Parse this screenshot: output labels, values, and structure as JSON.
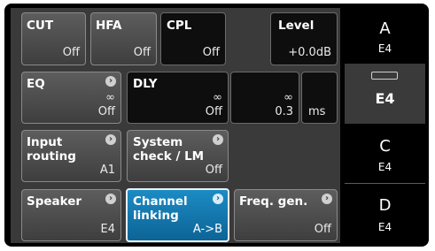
{
  "top_row": {
    "cut": {
      "label": "CUT",
      "value": "Off"
    },
    "hfa": {
      "label": "HFA",
      "value": "Off"
    },
    "cpl": {
      "label": "CPL",
      "value": "Off"
    },
    "level": {
      "label": "Level",
      "value": "+0.0dB"
    }
  },
  "second_row": {
    "eq": {
      "label": "EQ",
      "symbol": "∞",
      "value": "Off"
    },
    "dly": {
      "label": "DLY",
      "symbol": "∞",
      "value": "Off"
    },
    "dly_val": {
      "symbol": "∞",
      "value": "0.3"
    },
    "unit": {
      "value": "ms"
    }
  },
  "third_row": {
    "input_routing": {
      "label": "Input\nrouting",
      "value": "A1"
    },
    "system_check": {
      "label": "System\ncheck / LM",
      "value": "Off"
    }
  },
  "fourth_row": {
    "speaker": {
      "label": "Speaker",
      "value": "E4"
    },
    "channel_linking": {
      "label": "Channel\nlinking",
      "value": "A->B"
    },
    "freq_gen": {
      "label": "Freq. gen.",
      "value": "Off"
    }
  },
  "channels": [
    {
      "letter": "A",
      "model": "E4"
    },
    {
      "letter": "",
      "model": "E4"
    },
    {
      "letter": "C",
      "model": "E4"
    },
    {
      "letter": "D",
      "model": "E4"
    }
  ],
  "icons": {
    "chevron": "›"
  }
}
